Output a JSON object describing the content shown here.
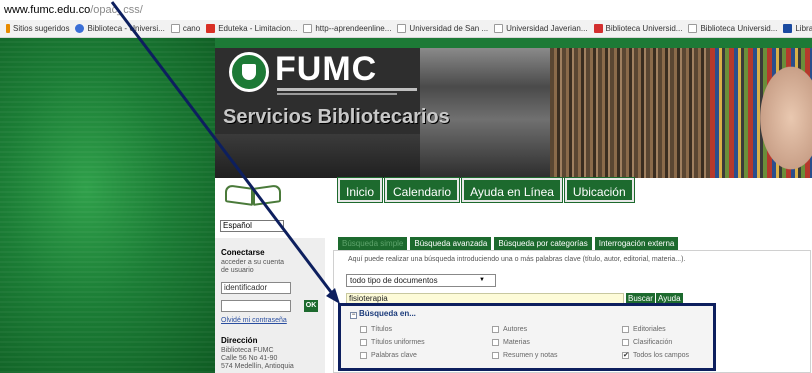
{
  "browser": {
    "url_host": "www.fumc.edu.co",
    "url_path": "/opac_css/",
    "bookmarks": [
      "Sitios sugeridos",
      "Biblioteca - Universi...",
      "cano",
      "Eduteka - Limitacion...",
      "http--aprendeenline...",
      "Universidad de San ...",
      "Universidad Javerian...",
      "Biblioteca Universid...",
      "Biblioteca Universid...",
      "Library of Con"
    ]
  },
  "header": {
    "logo_text": "FUMC",
    "title": "Servicios Bibliotecarios"
  },
  "nav": [
    "Inicio",
    "Calendario",
    "Ayuda en Línea",
    "Ubicación"
  ],
  "left": {
    "language": "Español",
    "connect_title": "Conectarse",
    "connect_desc": "acceder a su cuenta de usuario",
    "user_field": "identificador",
    "password_field": "",
    "ok_label": "OK",
    "forgot_link": "Olvidé mi contraseña",
    "address_title": "Dirección",
    "address_lines": [
      "Biblioteca FUMC",
      "Calle 56 No 41-90",
      "574 Medellín, Antioquia"
    ]
  },
  "search": {
    "tabs": [
      "Búsqueda simple",
      "Búsqueda avanzada",
      "Búsqueda por categorías",
      "Interrogación externa"
    ],
    "hint": "Aquí puede realizar una búsqueda introduciendo una o más palabras clave (título, autor, editorial, materia...).",
    "doc_type": "todo tipo de documentos",
    "query": "fisioterapia",
    "search_button": "Buscar",
    "help_button": "Ayuda",
    "in_title": "Búsqueda en...",
    "options": [
      {
        "label": "Títulos",
        "checked": false
      },
      {
        "label": "Autores",
        "checked": false
      },
      {
        "label": "Editoriales",
        "checked": false
      },
      {
        "label": "Títulos uniformes",
        "checked": false
      },
      {
        "label": "Materias",
        "checked": false
      },
      {
        "label": "Clasificación",
        "checked": false
      },
      {
        "label": "Palabras clave",
        "checked": false
      },
      {
        "label": "Resumen y notas",
        "checked": false
      },
      {
        "label": "Todos los campos",
        "checked": true
      }
    ]
  },
  "colors": {
    "green": "#1d6a2e",
    "annotation": "#0d1f5e",
    "query_bg": "#fdfbd8"
  }
}
